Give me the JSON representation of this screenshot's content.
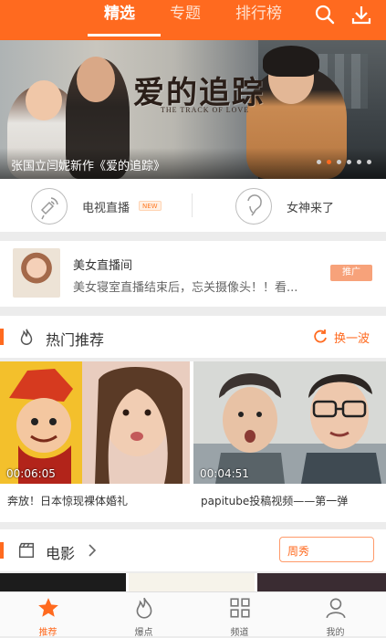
{
  "topbar": {
    "tabs": [
      {
        "label": "精选",
        "active": true
      },
      {
        "label": "专题",
        "active": false
      },
      {
        "label": "排行榜",
        "active": false
      }
    ],
    "icons": [
      "search-icon",
      "download-icon"
    ],
    "accent_color": "#ff6a1f"
  },
  "banner": {
    "title_art": "爱的追踪",
    "title_en": "THE TRACK OF LOVE",
    "caption": "张国立闫妮新作《爱的追踪》",
    "dots_count": 6,
    "active_dot": 1
  },
  "quick": {
    "tv_live": "电视直播",
    "new_badge": "NEW",
    "goddess": "女神来了"
  },
  "live_card": {
    "title": "美女直播间",
    "subtitle": "美女寝室直播结束后，忘关摄像头！！看...",
    "promo": "推广"
  },
  "hot": {
    "title": "热门推荐",
    "refresh": "换一波",
    "videos": [
      {
        "duration": "00:06:05",
        "title": "奔放！日本惊现裸体婚礼"
      },
      {
        "duration": "00:04:51",
        "title": "papitube投稿视频——第一弹"
      }
    ]
  },
  "movie": {
    "title": "电影",
    "button": "周秀"
  },
  "bottom_nav": [
    {
      "label": "推荐",
      "icon": "star-icon",
      "active": true
    },
    {
      "label": "爆点",
      "icon": "flame-icon",
      "active": false
    },
    {
      "label": "频道",
      "icon": "grid-icon",
      "active": false
    },
    {
      "label": "我的",
      "icon": "user-icon",
      "active": false
    }
  ]
}
